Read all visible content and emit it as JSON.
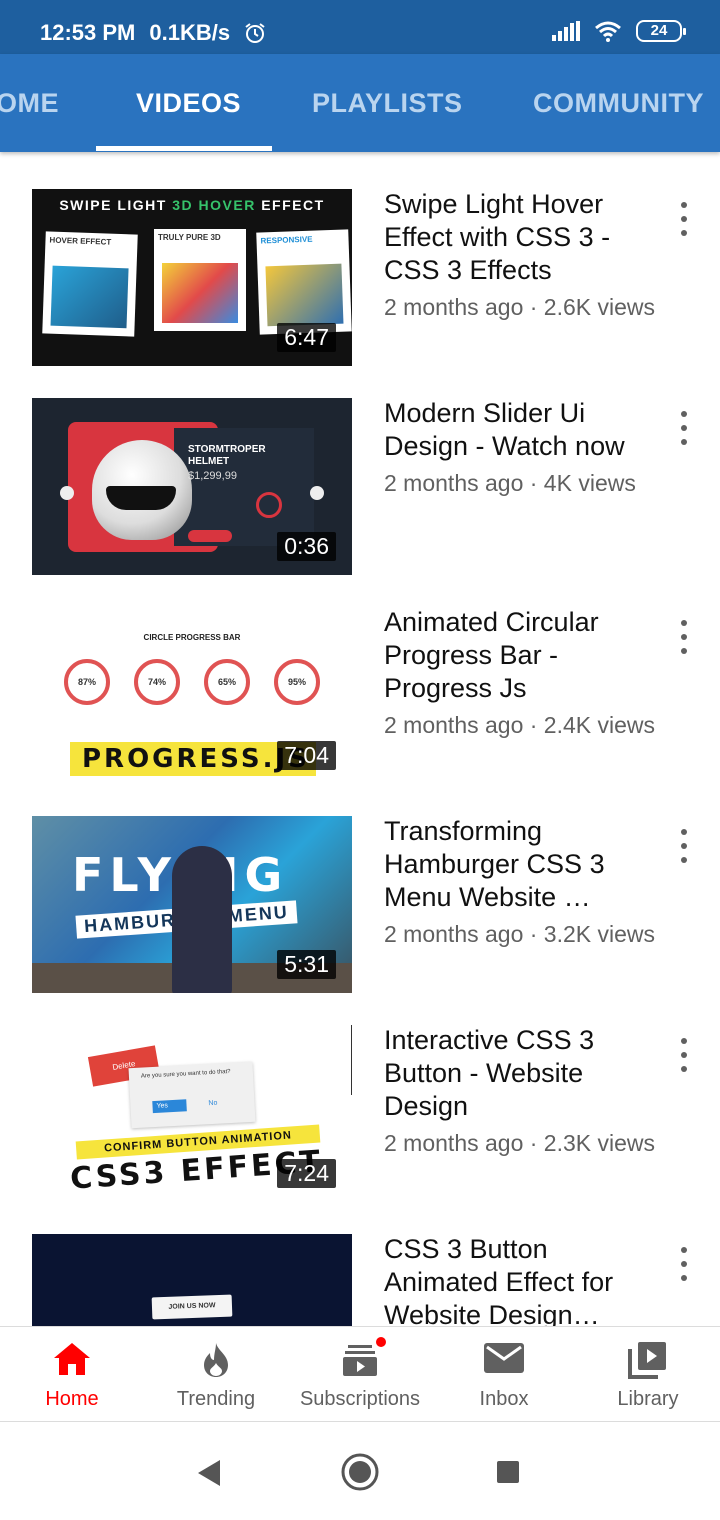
{
  "status_bar": {
    "time": "12:53 PM",
    "speed": "0.1KB/s",
    "battery": "24"
  },
  "tabs": [
    {
      "label": "OME"
    },
    {
      "label": "VIDEOS"
    },
    {
      "label": "PLAYLISTS"
    },
    {
      "label": "COMMUNITY"
    }
  ],
  "videos": [
    {
      "title": "Swipe Light Hover Effect with CSS 3 - CSS 3 Effects",
      "meta": "2 months ago · 2.6K views",
      "duration": "6:47",
      "thumb": {
        "header_a": "SWIPE LIGHT ",
        "header_b": "3D HOVER",
        "header_c": " EFFECT",
        "cards": [
          "HOVER EFFECT",
          "TRULY PURE 3D",
          "RESPONSIVE"
        ]
      }
    },
    {
      "title": "Modern Slider Ui Design - Watch now",
      "meta": "2 months ago · 4K views",
      "duration": "0:36",
      "thumb": {
        "name_line1": "STORMTROPER",
        "name_line2": "HELMET",
        "price": "$1,299,99",
        "ring": "88%"
      }
    },
    {
      "title": "Animated Circular Progress Bar - Progress Js",
      "meta": "2 months ago · 2.4K views",
      "duration": "7:04",
      "thumb": {
        "header": "CIRCLE PROGRESS BAR",
        "circles": [
          "87%",
          "74%",
          "65%",
          "95%"
        ],
        "band": "PROGRESS.JS"
      }
    },
    {
      "title": "Transforming Hamburger CSS 3 Menu  Website …",
      "meta": "2 months ago · 3.2K views",
      "duration": "5:31",
      "thumb": {
        "big": "FLYING",
        "sub": "HAMBURGER MENU"
      }
    },
    {
      "title": "Interactive CSS 3 Button - Website Design",
      "meta": "2 months ago · 2.3K views",
      "duration": "7:24",
      "thumb": {
        "delete": "Delete",
        "question": "Are you sure you want to do that?",
        "yes": "Yes",
        "no": "No",
        "band": "CONFIRM BUTTON ANIMATION",
        "big": "CSS3 EFFECT"
      }
    },
    {
      "title": "CSS 3 Button Animated Effect for Website Design…",
      "meta": "",
      "duration": "",
      "thumb": {
        "button": "JOIN US NOW"
      }
    }
  ],
  "bottom_nav": [
    {
      "label": "Home",
      "icon": "home-icon",
      "active": true
    },
    {
      "label": "Trending",
      "icon": "flame-icon",
      "active": false
    },
    {
      "label": "Subscriptions",
      "icon": "subscriptions-icon",
      "active": false,
      "badge": true
    },
    {
      "label": "Inbox",
      "icon": "mail-icon",
      "active": false
    },
    {
      "label": "Library",
      "icon": "library-icon",
      "active": false
    }
  ],
  "colors": {
    "status_bar": "#1e5f9f",
    "tab_bar": "#2a73bf",
    "active_nav": "#ff0000"
  }
}
